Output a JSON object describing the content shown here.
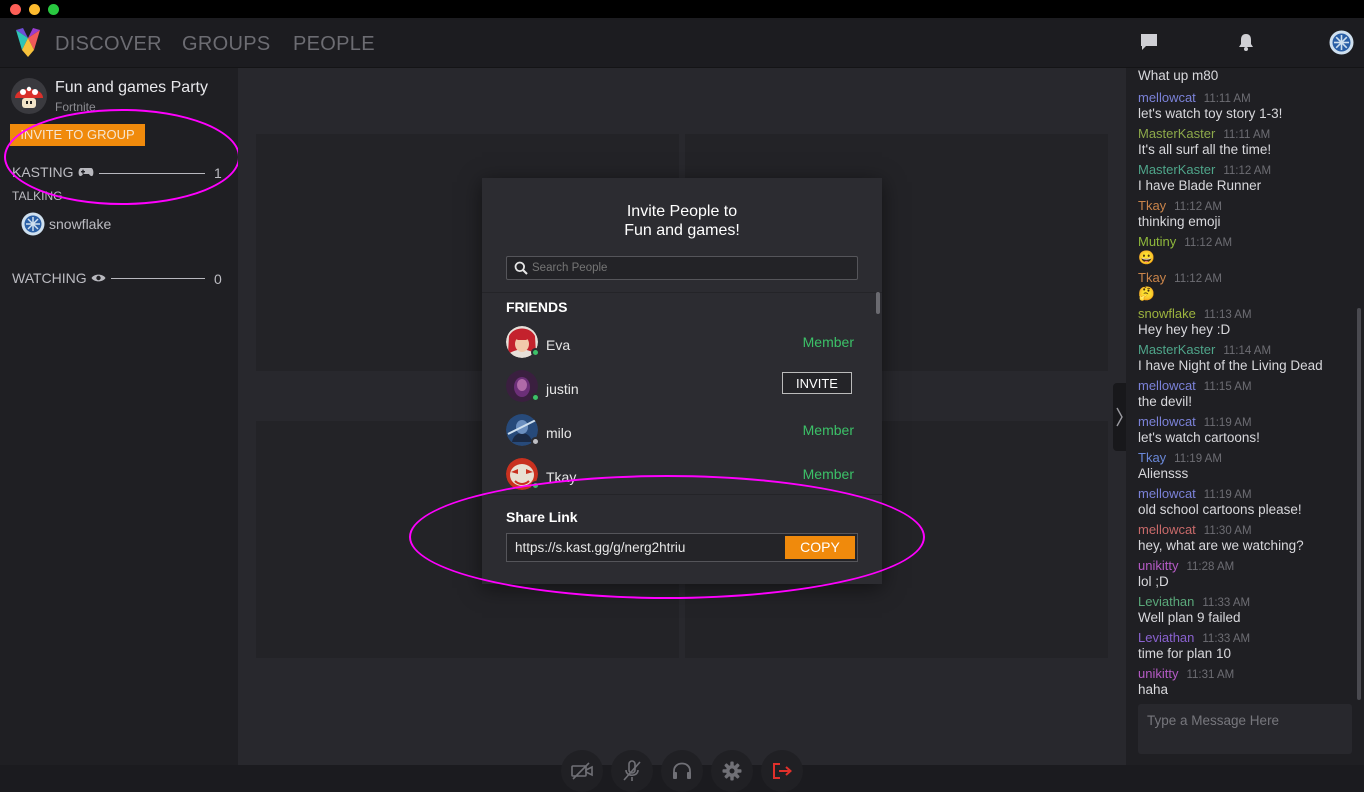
{
  "nav": {
    "links": [
      "DISCOVER",
      "GROUPS",
      "PEOPLE"
    ]
  },
  "party": {
    "title": "Fun and games Party",
    "game": "Fortnite",
    "invite_button": "INVITE TO GROUP",
    "kasting_label": "KASTING",
    "kasting_count": "1",
    "talking_label": "TALKING",
    "talking_user": "snowflake",
    "watching_label": "WATCHING",
    "watching_count": "0"
  },
  "modal": {
    "title_line1": "Invite People to",
    "title_line2": "Fun and games!",
    "search_placeholder": "Search People",
    "friends_heading": "FRIENDS",
    "friends": [
      {
        "name": "Eva",
        "action": "Member",
        "online": true
      },
      {
        "name": "justin",
        "action": "INVITE",
        "online": true
      },
      {
        "name": "milo",
        "action": "Member",
        "online": false
      },
      {
        "name": "Tkay",
        "action": "Member",
        "online": true
      }
    ],
    "share_heading": "Share Link",
    "share_url": "https://s.kast.gg/g/nerg2htriu",
    "copy_button": "COPY"
  },
  "chat": {
    "first_text": "What up m80",
    "messages": [
      {
        "name": "mellowcat",
        "color": "#7b82d8",
        "time": "11:11 AM",
        "text": "let's watch toy story 1-3!"
      },
      {
        "name": "MasterKaster",
        "color": "#8da94a",
        "time": "11:11 AM",
        "text": "It's all surf all the time!"
      },
      {
        "name": "MasterKaster",
        "color": "#4fa58a",
        "time": "11:12 AM",
        "text": "I have Blade Runner"
      },
      {
        "name": "Tkay",
        "color": "#c9844a",
        "time": "11:12 AM",
        "text": "thinking emoji"
      },
      {
        "name": "Mutiny",
        "color": "#8fb83c",
        "time": "11:12 AM",
        "text": "😀"
      },
      {
        "name": "Tkay",
        "color": "#c9844a",
        "time": "11:12 AM",
        "text": "🤔"
      },
      {
        "name": "snowflake",
        "color": "#9db43e",
        "time": "11:13 AM",
        "text": "Hey hey hey :D"
      },
      {
        "name": "MasterKaster",
        "color": "#4fa58a",
        "time": "11:14 AM",
        "text": "I have Night of the Living Dead"
      },
      {
        "name": "mellowcat",
        "color": "#7b82d8",
        "time": "11:15 AM",
        "text": "the devil!"
      },
      {
        "name": "mellowcat",
        "color": "#7b82d8",
        "time": "11:19 AM",
        "text": "let's watch cartoons!"
      },
      {
        "name": "Tkay",
        "color": "#6a88d8",
        "time": "11:19 AM",
        "text": "Aliensss"
      },
      {
        "name": "mellowcat",
        "color": "#7b82d8",
        "time": "11:19 AM",
        "text": "old school cartoons please!"
      },
      {
        "name": "mellowcat",
        "color": "#c96a6a",
        "time": "11:30 AM",
        "text": "hey, what are we watching?"
      },
      {
        "name": "unikitty",
        "color": "#b45ac4",
        "time": "11:28 AM",
        "text": "lol ;D"
      },
      {
        "name": "Leviathan",
        "color": "#5aa87a",
        "time": "11:33 AM",
        "text": "Well plan 9 failed"
      },
      {
        "name": "Leviathan",
        "color": "#8a62d0",
        "time": "11:33 AM",
        "text": "time for plan 10"
      },
      {
        "name": "unikitty",
        "color": "#b45ac4",
        "time": "11:31 AM",
        "text": "haha"
      }
    ],
    "input_placeholder": "Type a Message Here"
  },
  "colors": {
    "accent_orange": "#f08a0c",
    "member_green": "#3cc168",
    "highlight_magenta": "#ff00ff"
  }
}
